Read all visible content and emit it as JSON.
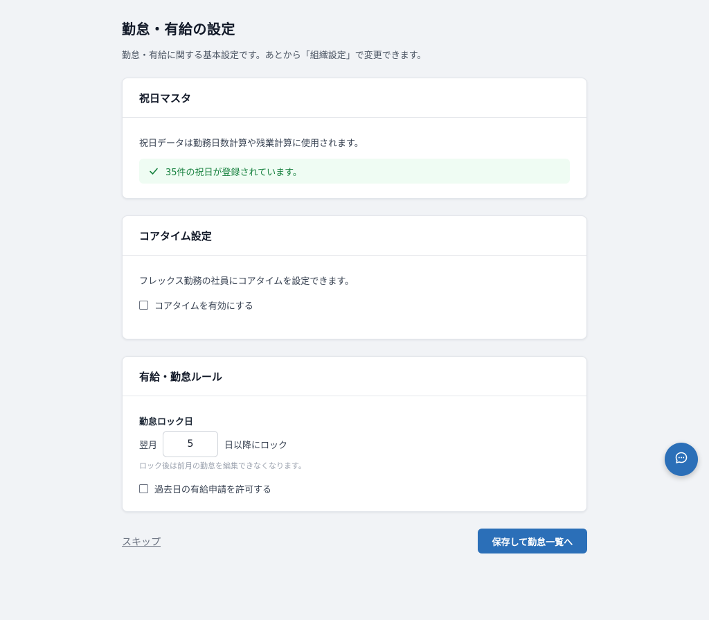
{
  "header": {
    "title": "勤怠・有給の設定",
    "description": "勤怠・有給に関する基本設定です。あとから「組織設定」で変更できます。"
  },
  "holiday_card": {
    "title": "祝日マスタ",
    "description": "祝日データは勤務日数計算や残業計算に使用されます。",
    "status_message": "35件の祝日が登録されています。",
    "status_icon": "check-icon",
    "status_color": "#15803d"
  },
  "coretime_card": {
    "title": "コアタイム設定",
    "description": "フレックス勤務の社員にコアタイムを設定できます。",
    "checkbox_label": "コアタイムを有効にする",
    "checkbox_checked": false
  },
  "rules_card": {
    "title": "有給・勤怠ルール",
    "lock_label": "勤怠ロック日",
    "lock_prefix": "翌月",
    "lock_day_value": "5",
    "lock_suffix": "日以降にロック",
    "lock_hint": "ロック後は前月の勤怠を編集できなくなります。",
    "past_leave_label": "過去日の有給申請を許可する",
    "past_leave_checked": false
  },
  "footer": {
    "skip_label": "スキップ",
    "save_label": "保存して勤怠一覧へ"
  },
  "chat": {
    "icon": "chat-bubble-icon"
  },
  "colors": {
    "accent": "#2b6fb8",
    "background": "#f1f3f6",
    "success_bg": "#effcf3"
  }
}
